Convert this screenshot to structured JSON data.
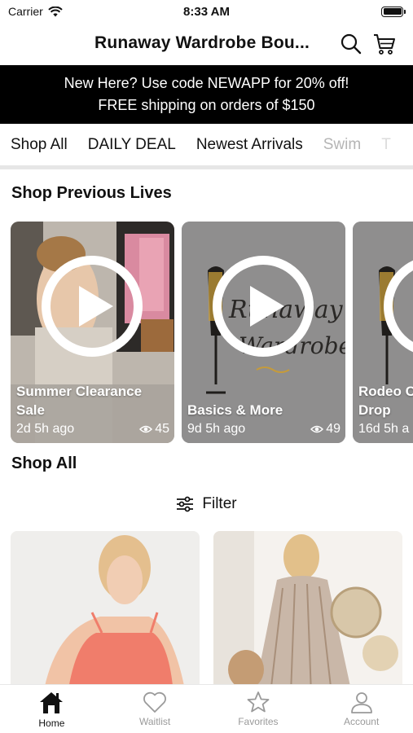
{
  "status_bar": {
    "carrier": "Carrier",
    "time": "8:33 AM"
  },
  "header": {
    "title": "Runaway Wardrobe Bou..."
  },
  "promo": {
    "line1": "New Here?  Use code NEWAPP for 20% off!",
    "line2": "FREE shipping on orders of $150"
  },
  "tabs": [
    {
      "label": "Shop All",
      "active": true
    },
    {
      "label": "DAILY DEAL"
    },
    {
      "label": "Newest Arrivals"
    },
    {
      "label": "Swim"
    },
    {
      "label": "T"
    }
  ],
  "lives_section": {
    "title": "Shop Previous Lives",
    "items": [
      {
        "title": "Summer Clearance Sale",
        "ago": "2d 5h ago",
        "views": "45"
      },
      {
        "title": "Basics & More",
        "ago": "9d 5h ago",
        "views": "49"
      },
      {
        "title": "Rodeo C Drop",
        "ago": "16d 5h a",
        "views": ""
      }
    ],
    "logo_text_line1": "Runaway",
    "logo_text_line2": "Wardrobe"
  },
  "shop_section": {
    "title": "Shop All",
    "filter_label": "Filter"
  },
  "products": [
    {
      "icon": "product-photo",
      "accent": "#f07d6b"
    },
    {
      "icon": "product-photo",
      "accent": "#c9b7a8"
    }
  ],
  "bottom_nav": [
    {
      "label": "Home",
      "icon": "home-icon",
      "active": true
    },
    {
      "label": "Waitlist",
      "icon": "heart-icon"
    },
    {
      "label": "Favorites",
      "icon": "star-icon"
    },
    {
      "label": "Account",
      "icon": "account-icon"
    }
  ],
  "colors": {
    "banner_bg": "#000000",
    "inactive_nav": "#9a9a9a"
  }
}
